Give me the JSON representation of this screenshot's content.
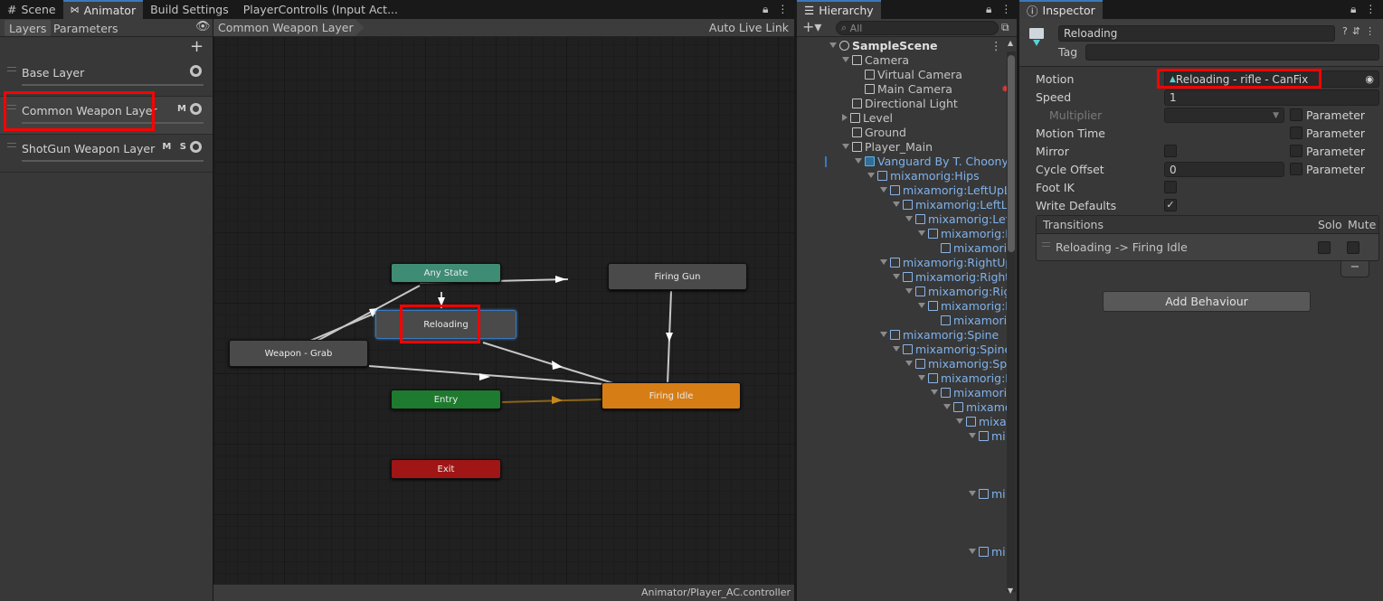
{
  "tabs_left": [
    {
      "label": "Scene",
      "icon": "grid-icon"
    },
    {
      "label": "Animator",
      "icon": "animator-icon"
    },
    {
      "label": "Build Settings"
    },
    {
      "label": "PlayerControlls (Input Act..."
    }
  ],
  "animator": {
    "subtabs": [
      "Layers",
      "Parameters"
    ],
    "layers": [
      {
        "name": "Base Layer",
        "flags": ""
      },
      {
        "name": "Common Weapon Layer",
        "flags": "M"
      },
      {
        "name": "ShotGun Weapon Layer",
        "flags": "M S"
      }
    ],
    "breadcrumb": "Common Weapon Layer",
    "auto_live_link": "Auto Live Link",
    "footer": "Animator/Player_AC.controller",
    "states": {
      "any_state": "Any State",
      "firing_gun": "Firing Gun",
      "reloading": "Reloading",
      "weapon_grab": "Weapon - Grab",
      "entry": "Entry",
      "firing_idle": "Firing Idle",
      "exit": "Exit"
    }
  },
  "hierarchy": {
    "title": "Hierarchy",
    "search_placeholder": "All",
    "items": [
      {
        "label": "SampleScene",
        "bold": true,
        "blue": false
      },
      {
        "label": "Camera",
        "bold": false,
        "blue": false
      },
      {
        "label": "Virtual Camera",
        "bold": false,
        "blue": false
      },
      {
        "label": "Main Camera",
        "bold": false,
        "blue": false
      },
      {
        "label": "Directional Light",
        "bold": false,
        "blue": false
      },
      {
        "label": "Level",
        "bold": false,
        "blue": false
      },
      {
        "label": "Ground",
        "bold": false,
        "blue": false
      },
      {
        "label": "Player_Main",
        "bold": false,
        "blue": false
      },
      {
        "label": "Vanguard By T. Choonyu",
        "bold": false,
        "blue": true
      },
      {
        "label": "mixamorig:Hips",
        "bold": false,
        "blue": true
      },
      {
        "label": "mixamorig:LeftUpLe",
        "bold": false,
        "blue": true
      },
      {
        "label": "mixamorig:LeftLe",
        "bold": false,
        "blue": true
      },
      {
        "label": "mixamorig:Left",
        "bold": false,
        "blue": true
      },
      {
        "label": "mixamorig:L",
        "bold": false,
        "blue": true
      },
      {
        "label": "mixamori",
        "bold": false,
        "blue": true
      },
      {
        "label": "mixamorig:RightUpL",
        "bold": false,
        "blue": true
      },
      {
        "label": "mixamorig:RightL",
        "bold": false,
        "blue": true
      },
      {
        "label": "mixamorig:Righ",
        "bold": false,
        "blue": true
      },
      {
        "label": "mixamorig:R",
        "bold": false,
        "blue": true
      },
      {
        "label": "mixamorig",
        "bold": false,
        "blue": true
      },
      {
        "label": "mixamorig:Spine",
        "bold": false,
        "blue": true
      },
      {
        "label": "mixamorig:Spine1",
        "bold": false,
        "blue": true
      },
      {
        "label": "mixamorig:Spi",
        "bold": false,
        "blue": true
      },
      {
        "label": "mixamorig:L",
        "bold": false,
        "blue": true
      },
      {
        "label": "mixamorig",
        "bold": false,
        "blue": true
      },
      {
        "label": "mixamo",
        "bold": false,
        "blue": true
      },
      {
        "label": "mixa",
        "bold": false,
        "blue": true
      },
      {
        "label": "mi",
        "bold": false,
        "blue": true
      },
      {
        "label": "mi",
        "bold": false,
        "blue": true
      },
      {
        "label": "mi",
        "bold": false,
        "blue": true
      }
    ]
  },
  "inspector": {
    "title": "Inspector",
    "object_name": "Reloading",
    "tag_label": "Tag",
    "fields": {
      "motion": "Motion",
      "speed": "Speed",
      "multiplier": "Multiplier",
      "motion_time": "Motion Time",
      "mirror": "Mirror",
      "cycle_offset": "Cycle Offset",
      "foot_ik": "Foot IK",
      "write_defaults": "Write Defaults"
    },
    "motion_value": "Reloading - rifle - CanFix",
    "speed_value": "1",
    "cycle_offset_value": "0",
    "parameter_label": "Parameter",
    "transitions": {
      "header": "Transitions",
      "solo": "Solo",
      "mute": "Mute",
      "items": [
        "Reloading -> Firing Idle"
      ]
    },
    "remove_label": "−",
    "add_behaviour": "Add Behaviour"
  },
  "colors": {
    "accent": "#3a79bb",
    "highlight": "#ff0000",
    "any_state": "#3f8c74",
    "entry": "#1e7a2f",
    "firing_idle": "#d67d16",
    "exit": "#a01515",
    "state": "#4a4a4a"
  }
}
